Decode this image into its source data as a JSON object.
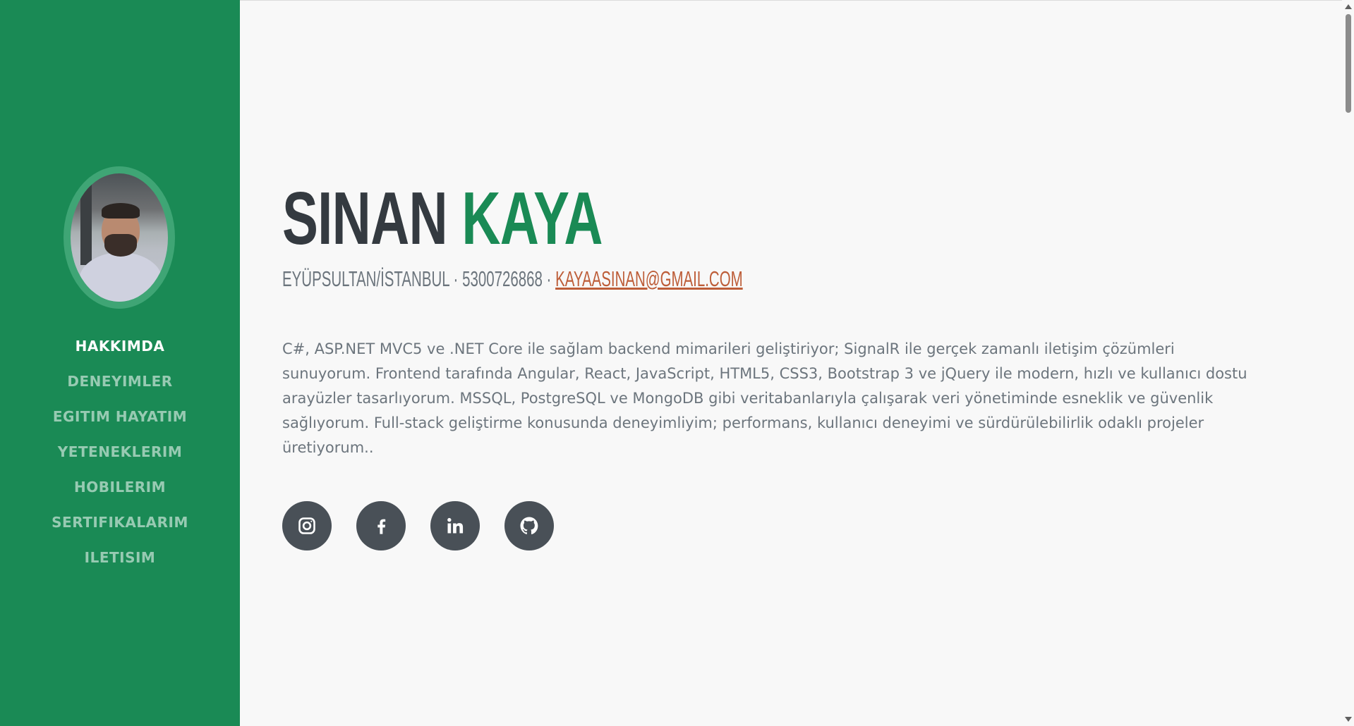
{
  "colors": {
    "sidebar": "#1a8a55",
    "accent": "#1a8a55",
    "link": "#bd5d38",
    "text": "#343a40",
    "muted": "#6c757d",
    "social_bg": "#495057"
  },
  "profile": {
    "avatar_icon": "profile-photo"
  },
  "nav": {
    "items": [
      {
        "label": "HAKKIMDA",
        "active": true
      },
      {
        "label": "DENEYIMLER",
        "active": false
      },
      {
        "label": "EGITIM HAYATIM",
        "active": false
      },
      {
        "label": "YETENEKLERIM",
        "active": false
      },
      {
        "label": "HOBILERIM",
        "active": false
      },
      {
        "label": "SERTIFIKALARIM",
        "active": false
      },
      {
        "label": "ILETISIM",
        "active": false
      }
    ]
  },
  "about": {
    "first_name": "SINAN",
    "last_name": "KAYA",
    "location": "EYÜPSULTAN/İSTANBUL",
    "separator": "·",
    "phone": "5300726868",
    "email": "KAYAASINAN@GMAIL.COM",
    "description": "C#, ASP.NET MVC5 ve .NET Core ile sağlam backend mimarileri geliştiriyor; SignalR ile gerçek zamanlı iletişim çözümleri sunuyorum. Frontend tarafında Angular, React, JavaScript, HTML5, CSS3, Bootstrap 3 ve jQuery ile modern, hızlı ve kullanıcı dostu arayüzler tasarlıyorum. MSSQL, PostgreSQL ve MongoDB gibi veritabanlarıyla çalışarak veri yönetiminde esneklik ve güvenlik sağlıyorum. Full-stack geliştirme konusunda deneyimliyim; performans, kullanıcı deneyimi ve sürdürülebilirlik odaklı projeler üretiyorum.."
  },
  "social": [
    {
      "icon": "instagram-icon"
    },
    {
      "icon": "facebook-icon"
    },
    {
      "icon": "linkedin-icon"
    },
    {
      "icon": "github-icon"
    }
  ]
}
